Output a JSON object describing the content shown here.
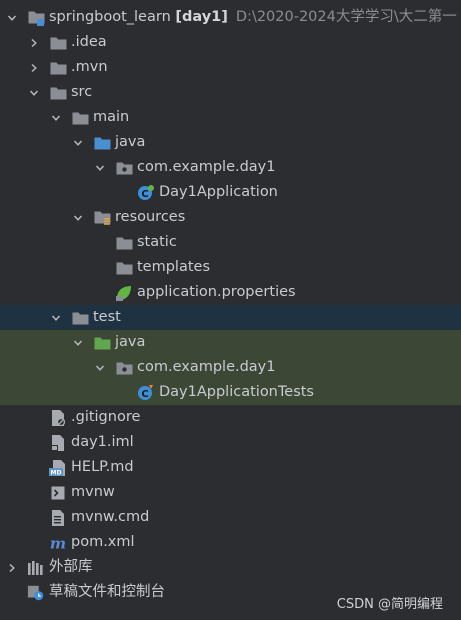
{
  "tree": [
    {
      "id": "springboot-learn-module",
      "depth": 0,
      "arrow": "down",
      "icon": "module-folder-icon",
      "label": "springboot_learn",
      "bold_suffix": "[day1]",
      "path": "D:\\2020-2024大学学习\\大二第一",
      "state": "normal"
    },
    {
      "id": "idea-folder",
      "depth": 1,
      "arrow": "right",
      "icon": "folder-icon",
      "label": ".idea",
      "state": "normal"
    },
    {
      "id": "mvn-folder",
      "depth": 1,
      "arrow": "right",
      "icon": "folder-icon",
      "label": ".mvn",
      "state": "normal"
    },
    {
      "id": "src-folder",
      "depth": 1,
      "arrow": "down",
      "icon": "folder-icon",
      "label": "src",
      "state": "normal"
    },
    {
      "id": "main-folder",
      "depth": 2,
      "arrow": "down",
      "icon": "folder-icon",
      "label": "main",
      "state": "normal"
    },
    {
      "id": "main-java-folder",
      "depth": 3,
      "arrow": "down",
      "icon": "source-folder-icon",
      "label": "java",
      "state": "normal"
    },
    {
      "id": "main-package",
      "depth": 4,
      "arrow": "down",
      "icon": "package-icon",
      "label": "com.example.day1",
      "state": "normal"
    },
    {
      "id": "day1application-class",
      "depth": 5,
      "arrow": "none",
      "icon": "spring-class-icon",
      "label": "Day1Application",
      "state": "normal"
    },
    {
      "id": "resources-folder",
      "depth": 3,
      "arrow": "down",
      "icon": "resources-folder-icon",
      "label": "resources",
      "state": "normal"
    },
    {
      "id": "static-folder",
      "depth": 4,
      "arrow": "none",
      "icon": "folder-icon",
      "label": "static",
      "state": "normal"
    },
    {
      "id": "templates-folder",
      "depth": 4,
      "arrow": "none",
      "icon": "folder-icon",
      "label": "templates",
      "state": "normal"
    },
    {
      "id": "application-properties-file",
      "depth": 4,
      "arrow": "none",
      "icon": "spring-properties-icon",
      "label": "application.properties",
      "state": "normal"
    },
    {
      "id": "test-folder",
      "depth": 2,
      "arrow": "down",
      "icon": "folder-icon",
      "label": "test",
      "state": "selected"
    },
    {
      "id": "test-java-folder",
      "depth": 3,
      "arrow": "down",
      "icon": "test-source-folder-icon",
      "label": "java",
      "state": "highlight"
    },
    {
      "id": "test-package",
      "depth": 4,
      "arrow": "down",
      "icon": "package-icon",
      "label": "com.example.day1",
      "state": "highlight"
    },
    {
      "id": "day1applicationtests-class",
      "depth": 5,
      "arrow": "none",
      "icon": "test-class-icon",
      "label": "Day1ApplicationTests",
      "state": "highlight"
    },
    {
      "id": "gitignore-file",
      "depth": 1,
      "arrow": "none",
      "icon": "ignore-file-icon",
      "label": ".gitignore",
      "state": "normal"
    },
    {
      "id": "day1-iml-file",
      "depth": 1,
      "arrow": "none",
      "icon": "iml-file-icon",
      "label": "day1.iml",
      "state": "normal"
    },
    {
      "id": "help-md-file",
      "depth": 1,
      "arrow": "none",
      "icon": "markdown-file-icon",
      "label": "HELP.md",
      "state": "normal"
    },
    {
      "id": "mvnw-file",
      "depth": 1,
      "arrow": "none",
      "icon": "terminal-file-icon",
      "label": "mvnw",
      "state": "normal"
    },
    {
      "id": "mvnw-cmd-file",
      "depth": 1,
      "arrow": "none",
      "icon": "text-file-icon",
      "label": "mvnw.cmd",
      "state": "normal"
    },
    {
      "id": "pom-xml-file",
      "depth": 1,
      "arrow": "none",
      "icon": "maven-icon",
      "label": "pom.xml",
      "state": "normal"
    },
    {
      "id": "external-libraries",
      "depth": 0,
      "arrow": "right",
      "icon": "libraries-icon",
      "label": "外部库",
      "state": "normal"
    },
    {
      "id": "scratches-consoles",
      "depth": 0,
      "arrow": "none",
      "icon": "scratches-icon",
      "label": "草稿文件和控制台",
      "state": "normal"
    }
  ],
  "colors": {
    "background": "#2b2d30",
    "selected": "#1f3242",
    "highlight": "#3d4736",
    "folder": "#8b8e94",
    "source_folder": "#4a8fd1",
    "test_folder": "#62a650"
  },
  "watermark": "CSDN @简明编程"
}
